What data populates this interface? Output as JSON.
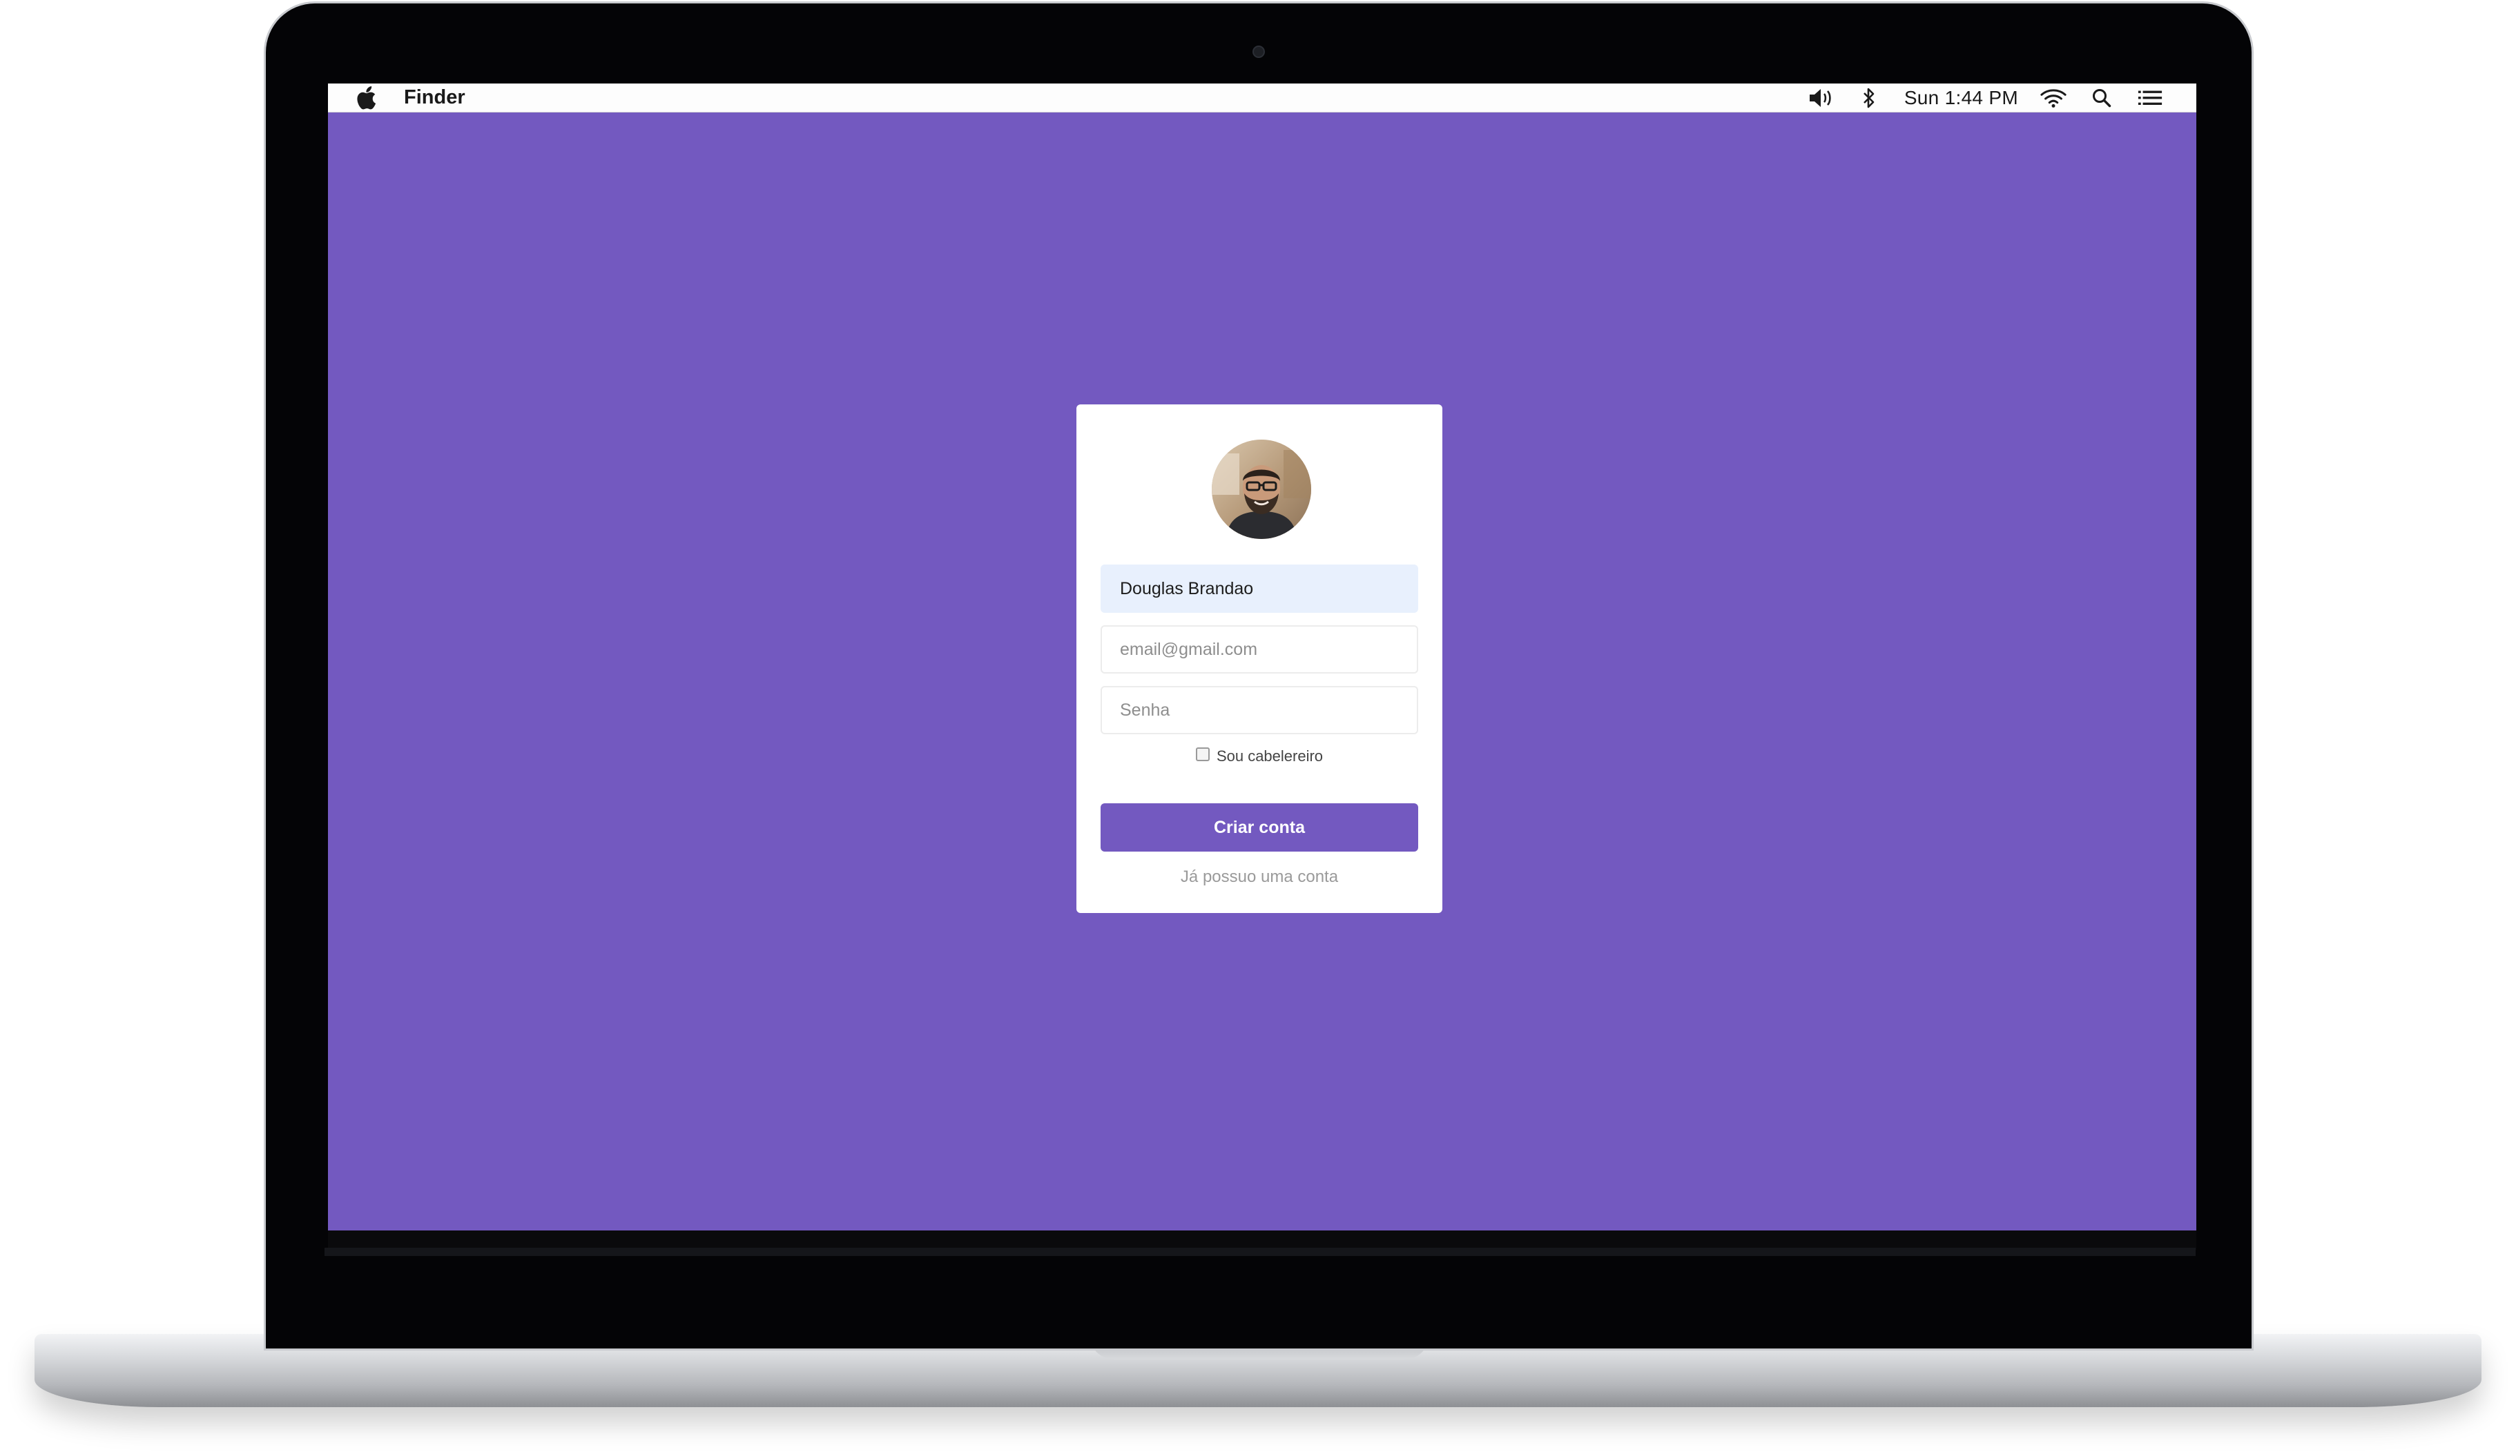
{
  "menubar": {
    "app_name": "Finder",
    "clock": "Sun 1:44 PM",
    "icons": [
      "apple-icon",
      "volume-icon",
      "bluetooth-icon",
      "wifi-icon",
      "search-icon",
      "list-icon"
    ]
  },
  "signup": {
    "name_value": "Douglas Brandao",
    "email_placeholder": "email@gmail.com",
    "password_placeholder": "Senha",
    "checkbox_label": "Sou cabelereiro",
    "checkbox_checked": false,
    "submit_label": "Criar conta",
    "login_link": "Já possuo uma conta"
  },
  "colors": {
    "background": "#7359c0",
    "button": "#7359c0",
    "card": "#ffffff",
    "autofill": "#e8f0fd"
  }
}
